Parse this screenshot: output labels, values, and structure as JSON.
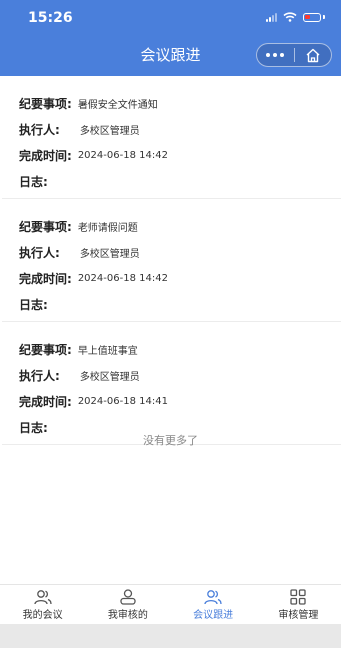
{
  "status_bar": {
    "time": "15:26"
  },
  "nav": {
    "title": "会议跟进"
  },
  "records": [
    {
      "item_label": "纪要事项:",
      "item": "暑假安全文件通知",
      "executor_label": "执行人:",
      "executor": "多校区管理员",
      "time_label": "完成时间:",
      "time": "2024-06-18 14:42",
      "log_label": "日志:"
    },
    {
      "item_label": "纪要事项:",
      "item": "老师请假问题",
      "executor_label": "执行人:",
      "executor": "多校区管理员",
      "time_label": "完成时间:",
      "time": "2024-06-18 14:42",
      "log_label": "日志:"
    },
    {
      "item_label": "纪要事项:",
      "item": "早上值班事宜",
      "executor_label": "执行人:",
      "executor": "多校区管理员",
      "time_label": "完成时间:",
      "time": "2024-06-18 14:41",
      "log_label": "日志:"
    }
  ],
  "list_footer": "没有更多了",
  "tabbar": [
    {
      "label": "我的会议",
      "icon": "people-icon"
    },
    {
      "label": "我审核的",
      "icon": "person-icon"
    },
    {
      "label": "会议跟进",
      "icon": "people-icon",
      "active": true
    },
    {
      "label": "审核管理",
      "icon": "grid-icon"
    }
  ],
  "colors": {
    "primary": "#4a7fdb",
    "battery_low": "#ff3b30"
  }
}
